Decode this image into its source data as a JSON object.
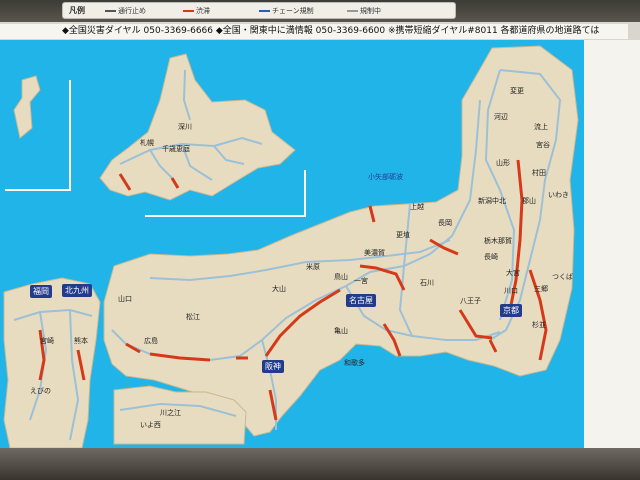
{
  "legend": {
    "title": "凡例",
    "items": [
      {
        "label": "通行止め",
        "color": "#555555"
      },
      {
        "label": "渋滞",
        "color": "#d43a1a"
      },
      {
        "label": "チェーン規制",
        "color": "#2a5fb0"
      },
      {
        "label": "規制中",
        "color": "#999999"
      }
    ]
  },
  "ticker": {
    "text": "◆全国災害ダイヤル 050-3369-6666 ◆全国・関東中に満情報 050-3369-6600 ※携帯短縮ダイヤル#8011 各都道府県の地道路ては"
  },
  "map": {
    "region_labels": {
      "fukuoka": "福岡",
      "kitakyushu": "北九州",
      "nagoya": "名古屋",
      "osaka": "阪神",
      "kyoto": "京都"
    },
    "city_labels": [
      "変更",
      "河辺",
      "流上",
      "宮谷",
      "山形",
      "村田",
      "新潟中北",
      "郡山",
      "いわき",
      "長岡",
      "栃木那賀",
      "上越",
      "更埴",
      "長崎",
      "大宮",
      "つくば",
      "川口",
      "三郷",
      "八王子",
      "美濃賀",
      "米原",
      "大山",
      "鳥山",
      "一宮",
      "亀山",
      "和歌多",
      "杉並",
      "札幌",
      "深川",
      "千歳恵庭",
      "山口",
      "広島",
      "松江",
      "宮崎",
      "熊本",
      "えびの",
      "川之江",
      "いよ西",
      "小矢部砺波",
      "石川"
    ]
  }
}
